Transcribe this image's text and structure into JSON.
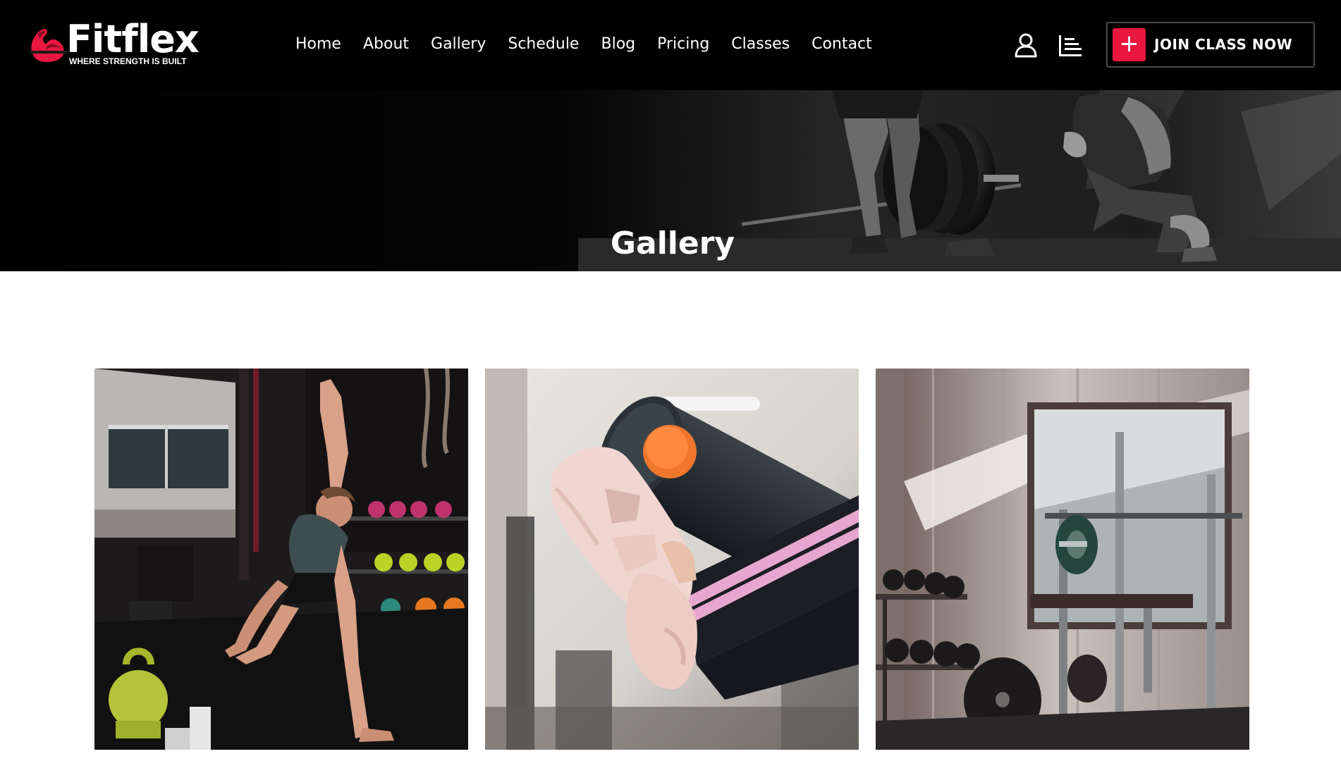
{
  "brand": {
    "name": "Fitflex",
    "tagline": "WHERE STRENGTH IS BUILT",
    "logo_icon": "flexed-arm-icon",
    "accent_color": "#e8173f"
  },
  "nav": {
    "items": [
      {
        "label": "Home"
      },
      {
        "label": "About"
      },
      {
        "label": "Gallery"
      },
      {
        "label": "Schedule"
      },
      {
        "label": "Blog"
      },
      {
        "label": "Pricing"
      },
      {
        "label": "Classes"
      },
      {
        "label": "Contact"
      }
    ]
  },
  "header_icons": {
    "account": "user-icon",
    "menu": "menu-lines-icon"
  },
  "cta": {
    "label": "JOIN CLASS NOW",
    "icon": "plus-icon",
    "icon_glyph": "+"
  },
  "hero": {
    "title": "Gallery",
    "background": "black-and-white gym photo"
  },
  "gallery": {
    "images": [
      {
        "name": "gallery-image-1",
        "subject": "woman doing side plank beside kettlebells"
      },
      {
        "name": "gallery-image-2",
        "subject": "pink sneakers resting on foam roller"
      },
      {
        "name": "gallery-image-3",
        "subject": "gym interior with dumbbell rack and barbell"
      }
    ]
  }
}
